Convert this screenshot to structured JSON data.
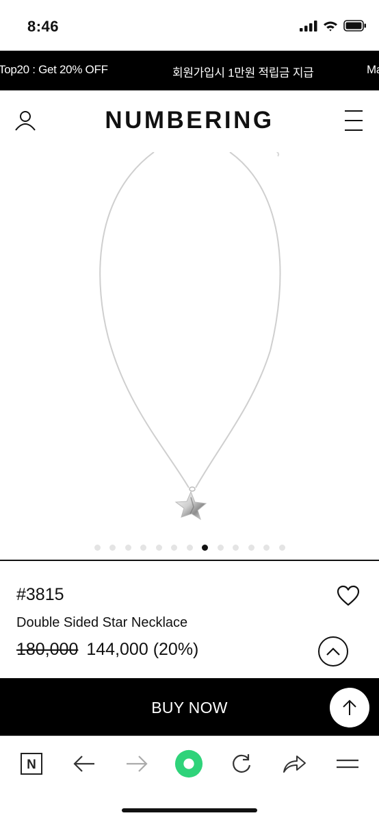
{
  "status_bar": {
    "time": "8:46"
  },
  "promo": {
    "items": [
      "Top20 : Get 20% OFF",
      "회원가입시 1만원 적립금 지급",
      "Ma"
    ]
  },
  "header": {
    "logo": "NUMBERING"
  },
  "carousel": {
    "total": 13,
    "active_index": 7
  },
  "product": {
    "number": "#3815",
    "name": "Double Sided Star Necklace",
    "original_price": "180,000",
    "sale_price": "144,000 (20%)"
  },
  "buy_bar": {
    "label": "BUY NOW"
  },
  "browser_toolbar": {
    "items": [
      "naver-n-icon",
      "back-arrow-icon",
      "forward-arrow-icon",
      "green-circle-icon",
      "reload-icon",
      "share-icon",
      "menu-icon"
    ],
    "accent_color": "#2fd37a",
    "logo_letter": "N"
  }
}
